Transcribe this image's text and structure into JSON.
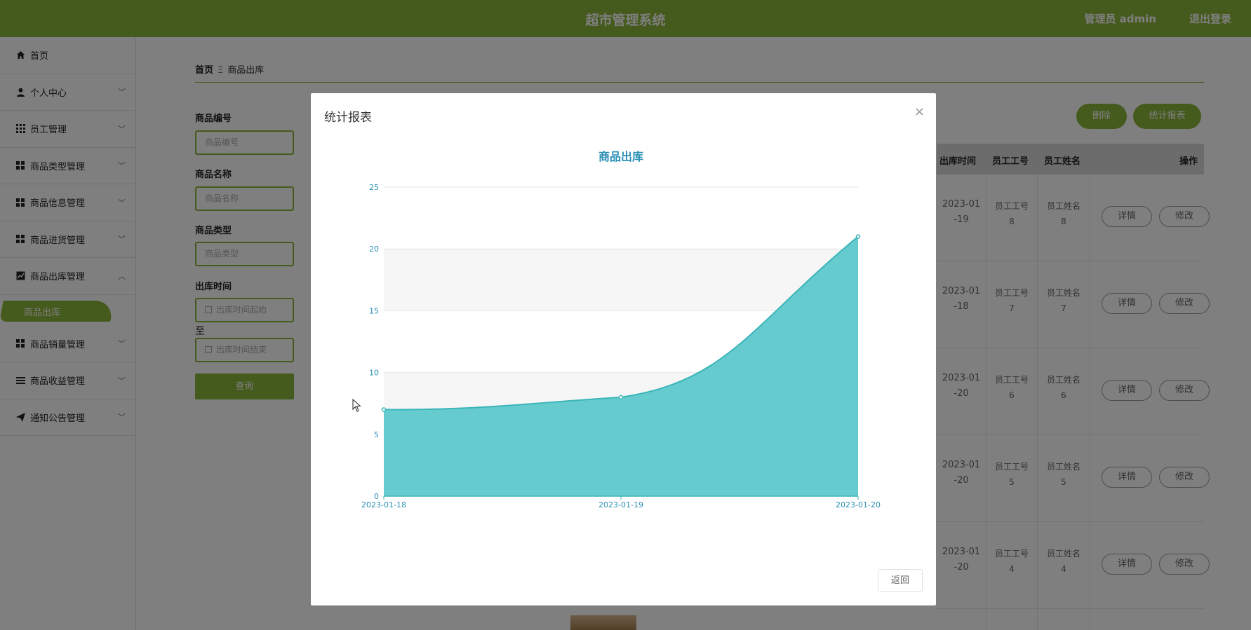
{
  "header": {
    "title": "超市管理系统",
    "user": "管理员 admin",
    "logout": "退出登录"
  },
  "sidebar": {
    "items": [
      {
        "label": "首页",
        "icon": "home-icon"
      },
      {
        "label": "个人中心",
        "icon": "user-icon"
      },
      {
        "label": "员工管理",
        "icon": "grid-icon"
      },
      {
        "label": "商品类型管理",
        "icon": "grid-icon"
      },
      {
        "label": "商品信息管理",
        "icon": "grid-icon"
      },
      {
        "label": "商品进货管理",
        "icon": "grid-icon"
      },
      {
        "label": "商品出库管理",
        "icon": "chart-icon"
      },
      {
        "label": "商品销量管理",
        "icon": "grid-icon"
      },
      {
        "label": "商品收益管理",
        "icon": "list-icon"
      },
      {
        "label": "通知公告管理",
        "icon": "send-icon"
      }
    ],
    "active_sub": "商品出库"
  },
  "breadcrumb": {
    "home": "首页",
    "sep": "Ξ",
    "current": "商品出库"
  },
  "form": {
    "code_label": "商品编号",
    "code_placeholder": "商品编号",
    "name_label": "商品名称",
    "name_placeholder": "商品名称",
    "type_label": "商品类型",
    "type_placeholder": "商品类型",
    "time_label": "出库时间",
    "time_start_placeholder": "出库时间起始",
    "to_label": "至",
    "time_end_placeholder": "出库时间结束",
    "query_button": "查询"
  },
  "actions": {
    "delete": "删除",
    "report": "统计报表"
  },
  "table": {
    "headers": [
      "出库时间",
      "员工工号",
      "员工姓名",
      "操作"
    ],
    "rows": [
      {
        "time_a": "2023-01",
        "time_b": "-19",
        "emp_no_a": "员工工号",
        "emp_no_b": "8",
        "emp_name_a": "员工姓名",
        "emp_name_b": "8"
      },
      {
        "time_a": "2023-01",
        "time_b": "-18",
        "emp_no_a": "员工工号",
        "emp_no_b": "7",
        "emp_name_a": "员工姓名",
        "emp_name_b": "7"
      },
      {
        "time_a": "2023-01",
        "time_b": "-20",
        "emp_no_a": "员工工号",
        "emp_no_b": "6",
        "emp_name_a": "员工姓名",
        "emp_name_b": "6"
      },
      {
        "time_a": "2023-01",
        "time_b": "-20",
        "emp_no_a": "员工工号",
        "emp_no_b": "5",
        "emp_name_a": "员工姓名",
        "emp_name_b": "5"
      },
      {
        "time_a": "2023-01",
        "time_b": "-20",
        "emp_no_a": "员工工号",
        "emp_no_b": "4",
        "emp_name_a": "员工姓名",
        "emp_name_b": "4"
      }
    ],
    "detail_button": "详情",
    "edit_button": "修改"
  },
  "modal": {
    "title": "统计报表",
    "close": "×",
    "back_button": "返回"
  },
  "chart_data": {
    "type": "area",
    "title": "商品出库",
    "categories": [
      "2023-01-18",
      "2023-01-19",
      "2023-01-20"
    ],
    "values": [
      7,
      8,
      21
    ],
    "ylim": [
      0,
      25
    ],
    "yticks": [
      0,
      5,
      10,
      15,
      20,
      25
    ],
    "smooth": true,
    "color": "#5ec8cc",
    "line_color": "#3bb5b8",
    "grid": "banded"
  },
  "colors": {
    "brand": "#8bb53a",
    "chart_axis": "#2a8fb5"
  }
}
